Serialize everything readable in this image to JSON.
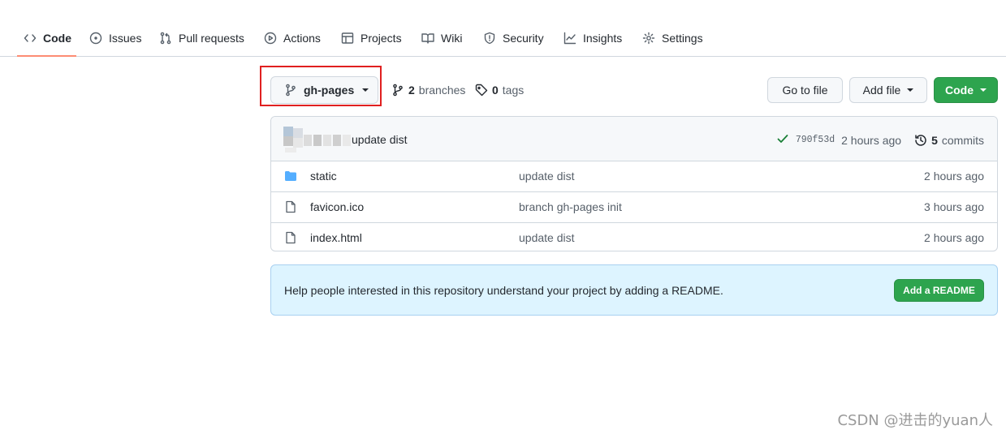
{
  "nav": {
    "tabs": [
      {
        "label": "Code",
        "icon": "code-icon",
        "selected": true
      },
      {
        "label": "Issues",
        "icon": "issue-opened-icon"
      },
      {
        "label": "Pull requests",
        "icon": "git-pull-request-icon"
      },
      {
        "label": "Actions",
        "icon": "play-icon"
      },
      {
        "label": "Projects",
        "icon": "table-icon"
      },
      {
        "label": "Wiki",
        "icon": "book-icon"
      },
      {
        "label": "Security",
        "icon": "shield-icon"
      },
      {
        "label": "Insights",
        "icon": "graph-icon"
      },
      {
        "label": "Settings",
        "icon": "gear-icon"
      }
    ],
    "selected_underline_color": "#fd8c73"
  },
  "branch": {
    "current": "gh-pages",
    "branches_count": "2",
    "branches_label": "branches",
    "tags_count": "0",
    "tags_label": "tags",
    "highlight_color": "#e02020"
  },
  "actions": {
    "go_to_file": "Go to file",
    "add_file": "Add file",
    "code": "Code",
    "code_button_color": "#2da44e"
  },
  "latest_commit": {
    "message": "update dist",
    "status": "success",
    "sha": "790f53d",
    "age": "2 hours ago",
    "commits_count": "5",
    "commits_label": "commits"
  },
  "files": [
    {
      "type": "directory",
      "icon": "folder-icon",
      "name": "static",
      "commit": "update dist",
      "age": "2 hours ago"
    },
    {
      "type": "file",
      "icon": "file-icon",
      "name": "favicon.ico",
      "commit": "branch gh-pages init",
      "age": "3 hours ago"
    },
    {
      "type": "file",
      "icon": "file-icon",
      "name": "index.html",
      "commit": "update dist",
      "age": "2 hours ago"
    }
  ],
  "readme_prompt": {
    "text": "Help people interested in this repository understand your project by adding a README.",
    "button": "Add a README"
  },
  "watermark": "CSDN @进击的yuan人"
}
